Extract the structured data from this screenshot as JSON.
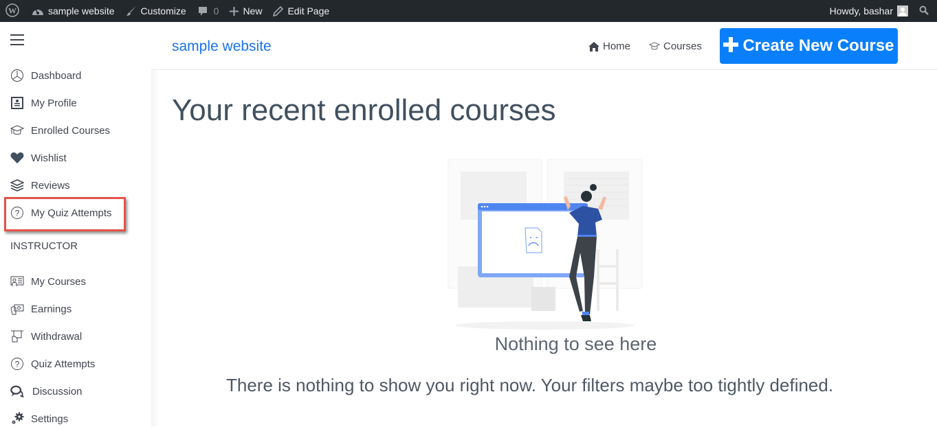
{
  "adminbar": {
    "wp_logo": "wordpress-icon",
    "site_name": "sample website",
    "customize": "Customize",
    "comments_count": "0",
    "new": "New",
    "edit_page": "Edit Page",
    "greeting": "Howdy, bashar"
  },
  "sidebar": {
    "items": [
      {
        "label": "Dashboard",
        "icon": "dashboard-icon"
      },
      {
        "label": "My Profile",
        "icon": "profile-icon"
      },
      {
        "label": "Enrolled Courses",
        "icon": "graduation-cap-icon"
      },
      {
        "label": "Wishlist",
        "icon": "heart-icon"
      },
      {
        "label": "Reviews",
        "icon": "layers-icon"
      },
      {
        "label": "My Quiz Attempts",
        "icon": "question-circle-icon",
        "highlighted": true
      }
    ],
    "section_label": "INSTRUCTOR",
    "instructor_items": [
      {
        "label": "My Courses",
        "icon": "my-courses-icon"
      },
      {
        "label": "Earnings",
        "icon": "earnings-icon"
      },
      {
        "label": "Withdrawal",
        "icon": "withdrawal-icon"
      },
      {
        "label": "Quiz Attempts",
        "icon": "question-circle-icon"
      },
      {
        "label": "Discussion",
        "icon": "discussion-icon"
      },
      {
        "label": "Settings",
        "icon": "settings-icon"
      }
    ]
  },
  "header": {
    "brand": "sample website",
    "nav": [
      {
        "label": "Home",
        "icon": "home-icon"
      },
      {
        "label": "Courses",
        "icon": "graduation-cap-icon"
      }
    ],
    "create_button": "Create New Course",
    "accent_color": "#0a7ffb"
  },
  "main": {
    "title": "Your recent enrolled courses",
    "empty_title": "Nothing to see here",
    "empty_description": "There is nothing to show you right now. Your filters maybe too tightly defined."
  }
}
